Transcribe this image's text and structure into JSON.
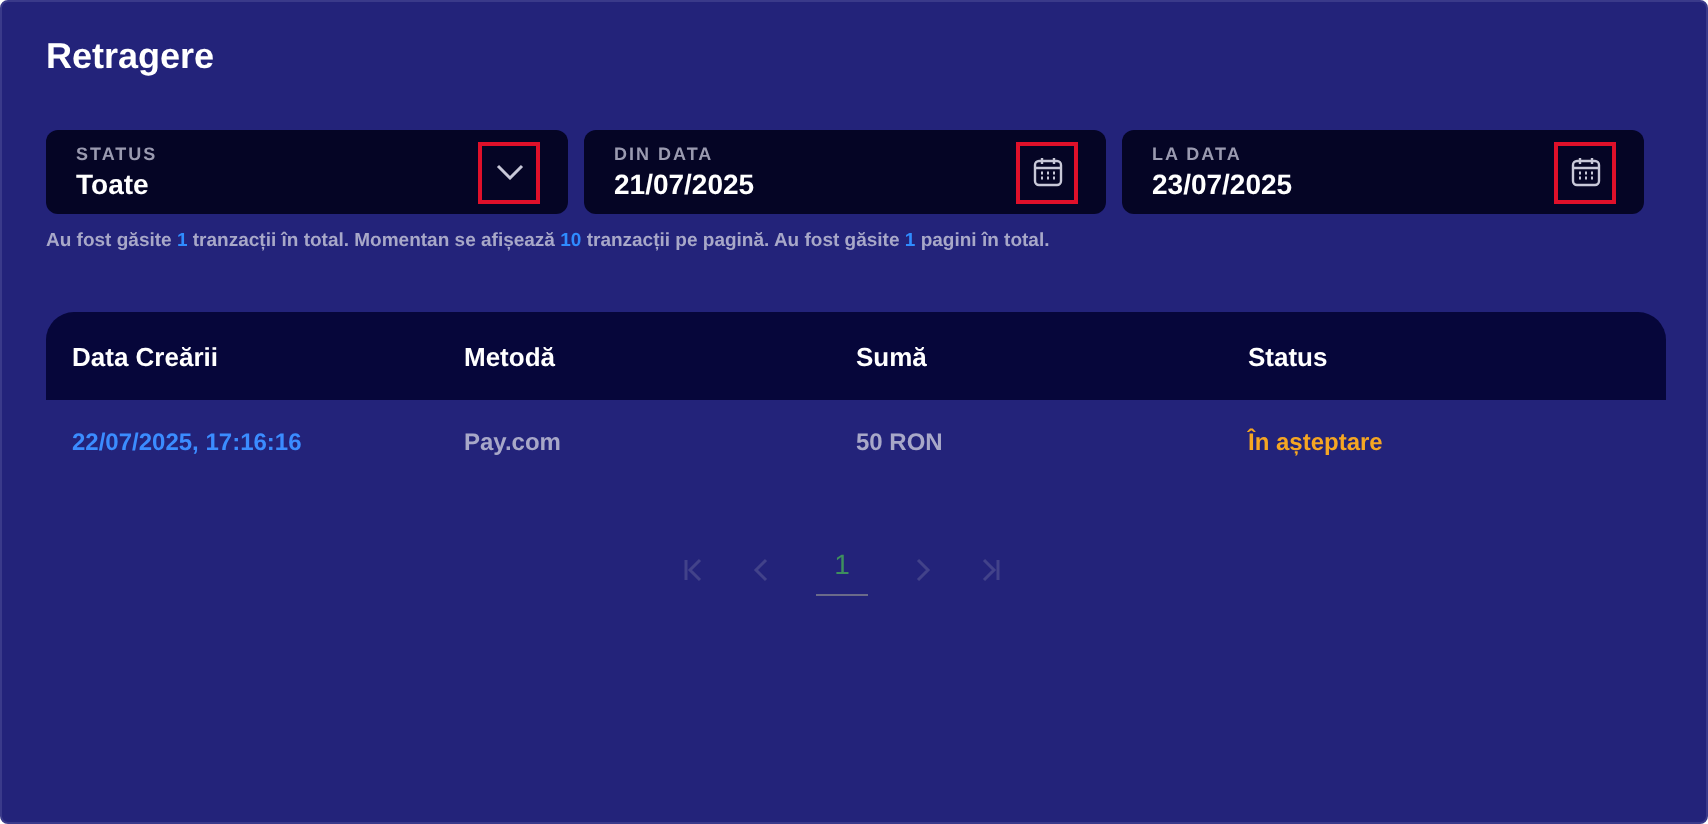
{
  "title": "Retragere",
  "filters": [
    {
      "kind": "select",
      "label": "STATUS",
      "value": "Toate",
      "highlighted": true
    },
    {
      "kind": "date",
      "label": "DIN DATA",
      "value": "21/07/2025",
      "highlighted": true
    },
    {
      "kind": "date",
      "label": "LA DATA",
      "value": "23/07/2025",
      "highlighted": true
    }
  ],
  "summary": [
    {
      "text": "Au fost găsite ",
      "accent": false
    },
    {
      "text": "1",
      "accent": true
    },
    {
      "text": " tranzacții în total. Momentan se afișează ",
      "accent": false
    },
    {
      "text": "10",
      "accent": true
    },
    {
      "text": " tranzacții pe pagină. Au fost găsite ",
      "accent": false
    },
    {
      "text": "1",
      "accent": true
    },
    {
      "text": " pagini în total.",
      "accent": false
    }
  ],
  "table": {
    "columns": [
      "Data Creării",
      "Metodă",
      "Sumă",
      "Status"
    ],
    "rows": [
      {
        "cells": [
          "22/07/2025, 17:16:16",
          "Pay.com",
          "50 RON",
          "În așteptare"
        ],
        "color": "#f5a623"
      }
    ]
  },
  "pagination": {
    "first": {
      "disabled": true
    },
    "prev": {
      "disabled": true
    },
    "pages": [
      {
        "label": "1",
        "selected": true
      }
    ],
    "next": {
      "disabled": true
    },
    "last": {
      "disabled": true
    }
  }
}
